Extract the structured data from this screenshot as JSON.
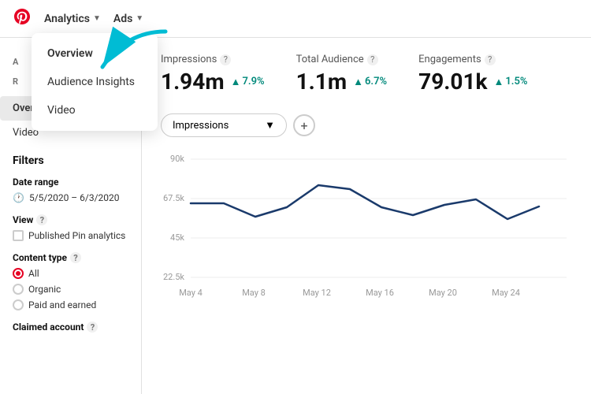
{
  "topNav": {
    "logoSymbol": "P",
    "analyticsLabel": "Analytics",
    "adsLabel": "Ads"
  },
  "dropdown": {
    "items": [
      {
        "id": "overview",
        "label": "Overview",
        "active": true
      },
      {
        "id": "audience-insights",
        "label": "Audience Insights",
        "active": false
      },
      {
        "id": "video",
        "label": "Video",
        "active": false
      }
    ]
  },
  "sidebar": {
    "sectionA": "A",
    "sectionR": "R",
    "items": [
      {
        "id": "overview",
        "label": "Overview",
        "active": true
      },
      {
        "id": "video",
        "label": "Video",
        "active": false
      }
    ]
  },
  "filters": {
    "title": "Filters",
    "dateRange": {
      "label": "Date range",
      "value": "5/5/2020 – 6/3/2020"
    },
    "view": {
      "label": "View",
      "helpText": "?",
      "checkbox": {
        "label": "Published Pin analytics",
        "checked": false
      }
    },
    "contentType": {
      "label": "Content type",
      "helpText": "?",
      "options": [
        {
          "id": "all",
          "label": "All",
          "selected": true
        },
        {
          "id": "organic",
          "label": "Organic",
          "selected": false
        },
        {
          "id": "paid-earned",
          "label": "Paid and earned",
          "selected": false
        }
      ]
    },
    "claimedAccount": {
      "label": "Claimed account",
      "helpText": "?"
    }
  },
  "metrics": [
    {
      "id": "impressions",
      "title": "Impressions",
      "value": "1.94m",
      "change": "7.9%",
      "positive": true
    },
    {
      "id": "total-audience",
      "title": "Total Audience",
      "value": "1.1m",
      "change": "6.7%",
      "positive": true
    },
    {
      "id": "engagements",
      "title": "Engagements",
      "value": "79.01k",
      "change": "1.5%",
      "positive": true
    }
  ],
  "chart": {
    "selectLabel": "Impressions",
    "addButtonLabel": "+",
    "yAxis": [
      "90k",
      "67.5k",
      "45k",
      "22.5k"
    ],
    "xAxis": [
      "May 4",
      "May 8",
      "May 12",
      "May 16",
      "May 20",
      "May 24"
    ],
    "helpIcon": "?"
  }
}
